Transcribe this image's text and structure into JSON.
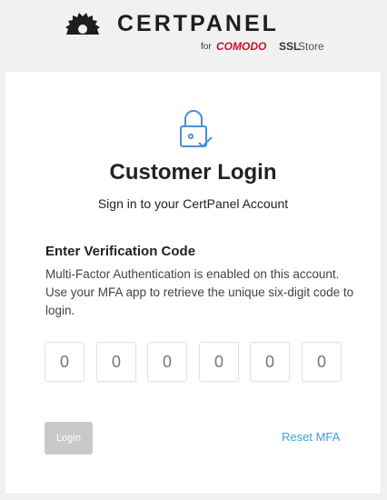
{
  "brand": {
    "name": "CERTPANEL",
    "for_text": "for",
    "comodo_text": "COMODO",
    "ssl_text": "SSL",
    "store_text": "Store",
    "logo_icon": "sawblade-logo-icon"
  },
  "card": {
    "icon": "lock-check-icon",
    "title": "Customer Login",
    "subtitle": "Sign in to your CertPanel Account",
    "section_heading": "Enter Verification Code",
    "section_description": "Multi-Factor Authentication is enabled on this account. Use your MFA app to retrieve the unique six-digit code to login."
  },
  "code_inputs": {
    "placeholders": [
      "0",
      "0",
      "0",
      "0",
      "0",
      "0"
    ],
    "values": [
      "",
      "",
      "",
      "",
      "",
      ""
    ]
  },
  "actions": {
    "login_label": "Login",
    "reset_label": "Reset MFA"
  },
  "colors": {
    "page_bg": "#f1f1f1",
    "card_bg": "#ffffff",
    "brand_dark": "#1e1e1e",
    "comodo_red": "#c8102e",
    "link_blue": "#3aa0dc",
    "icon_blue": "#4a90d9",
    "disabled_button": "#c9c9c9"
  }
}
